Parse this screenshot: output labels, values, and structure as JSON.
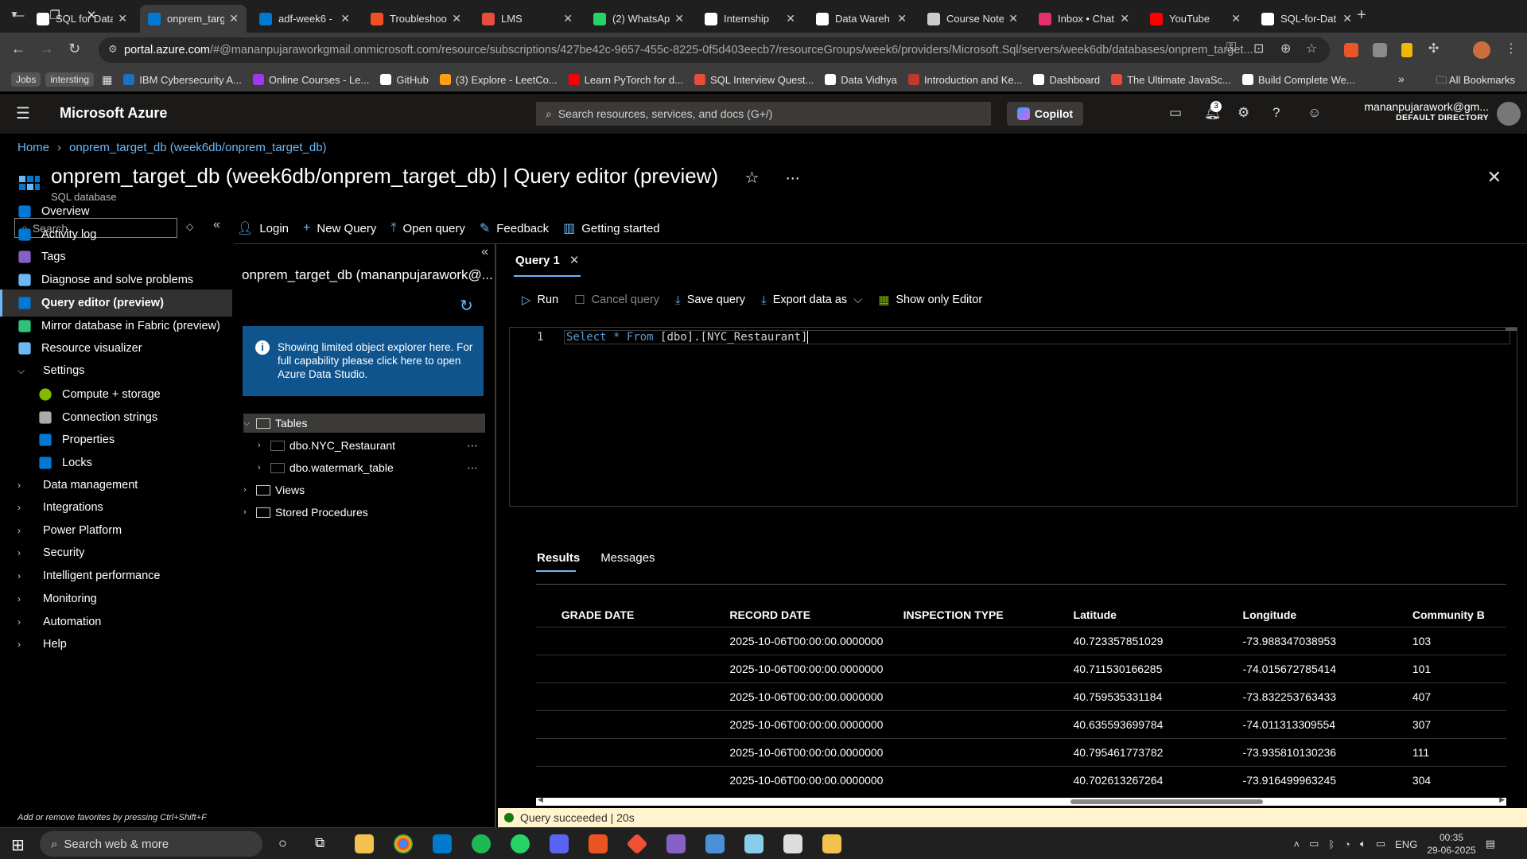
{
  "browser": {
    "tabs": [
      {
        "label": "SQL for Data",
        "color": "#ffffff",
        "active": false
      },
      {
        "label": "onprem_targ",
        "color": "#0078d4",
        "active": true
      },
      {
        "label": "adf-week6 -",
        "color": "#0078d4",
        "active": false
      },
      {
        "label": "Troubleshoot",
        "color": "#f25022",
        "active": false
      },
      {
        "label": "LMS",
        "color": "#e74c3c",
        "active": false
      },
      {
        "label": "(2) WhatsAp",
        "color": "#25d366",
        "active": false
      },
      {
        "label": "Internship",
        "color": "#ffffff",
        "active": false
      },
      {
        "label": "Data Wareh",
        "color": "#ffffff",
        "active": false
      },
      {
        "label": "Course Note",
        "color": "#cccccc",
        "active": false
      },
      {
        "label": "Inbox • Chat",
        "color": "#e1306c",
        "active": false
      },
      {
        "label": "YouTube",
        "color": "#ff0000",
        "active": false
      },
      {
        "label": "SQL-for-Dat",
        "color": "#ffffff",
        "active": false
      }
    ],
    "url_host": "portal.azure.com",
    "url_path": "/#@mananpujaraworkgmail.onmicrosoft.com/resource/subscriptions/427be42c-9657-455c-8225-0f5d403eecb7/resourceGroups/week6/providers/Microsoft.Sql/servers/week6db/databases/onprem_target...",
    "bookmarks_chips": [
      "Jobs",
      "intersting"
    ],
    "bookmarks": [
      {
        "label": "IBM Cybersecurity A...",
        "color": "#1f70c1"
      },
      {
        "label": "Online Courses - Le...",
        "color": "#a435f0"
      },
      {
        "label": "GitHub",
        "color": "#ffffff"
      },
      {
        "label": "(3) Explore - LeetCo...",
        "color": "#ffa116"
      },
      {
        "label": "Learn PyTorch for d...",
        "color": "#ff0000"
      },
      {
        "label": "SQL Interview Quest...",
        "color": "#e74c3c"
      },
      {
        "label": "Data Vidhya",
        "color": "#ffffff"
      },
      {
        "label": "Introduction and Ke...",
        "color": "#c0392b"
      },
      {
        "label": "Dashboard",
        "color": "#ffffff"
      },
      {
        "label": "The Ultimate JavaSc...",
        "color": "#e74c3c"
      },
      {
        "label": "Build Complete We...",
        "color": "#ffffff"
      }
    ],
    "all_bookmarks": "All Bookmarks"
  },
  "azure": {
    "brand": "Microsoft Azure",
    "search_placeholder": "Search resources, services, and docs (G+/)",
    "copilot": "Copilot",
    "notif_count": "3",
    "account_email": "mananpujarawork@gm...",
    "account_dir": "DEFAULT DIRECTORY"
  },
  "page": {
    "breadcrumb_home": "Home",
    "breadcrumb_db": "onprem_target_db (week6db/onprem_target_db)",
    "title": "onprem_target_db (week6db/onprem_target_db) | Query editor (preview)",
    "subtitle": "SQL database"
  },
  "nav": {
    "search_placeholder": "Search",
    "items": [
      {
        "label": "Overview",
        "icon": "sql-db-icon",
        "color": "#0078d4"
      },
      {
        "label": "Activity log",
        "icon": "log-icon",
        "color": "#0078d4"
      },
      {
        "label": "Tags",
        "icon": "tag-icon",
        "color": "#8661c5"
      },
      {
        "label": "Diagnose and solve problems",
        "icon": "wrench-icon",
        "color": "#6cb8f6"
      },
      {
        "label": "Query editor (preview)",
        "icon": "query-icon",
        "color": "#0078d4"
      },
      {
        "label": "Mirror database in Fabric (preview)",
        "icon": "fabric-icon",
        "color": "#2ec27e"
      },
      {
        "label": "Resource visualizer",
        "icon": "visualizer-icon",
        "color": "#6cb8f6"
      },
      {
        "label": "Settings",
        "icon": "chevron-down-icon"
      },
      {
        "label": "Compute + storage",
        "icon": "compute-icon",
        "color": "#7fba00"
      },
      {
        "label": "Connection strings",
        "icon": "link-icon",
        "color": "#aaaaaa"
      },
      {
        "label": "Properties",
        "icon": "properties-icon",
        "color": "#0078d4"
      },
      {
        "label": "Locks",
        "icon": "lock-icon",
        "color": "#0078d4"
      },
      {
        "label": "Data management",
        "icon": "chevron-right-icon"
      },
      {
        "label": "Integrations",
        "icon": "chevron-right-icon"
      },
      {
        "label": "Power Platform",
        "icon": "chevron-right-icon"
      },
      {
        "label": "Security",
        "icon": "chevron-right-icon"
      },
      {
        "label": "Intelligent performance",
        "icon": "chevron-right-icon"
      },
      {
        "label": "Monitoring",
        "icon": "chevron-right-icon"
      },
      {
        "label": "Automation",
        "icon": "chevron-right-icon"
      },
      {
        "label": "Help",
        "icon": "chevron-right-icon"
      }
    ],
    "hint": "Add or remove favorites by pressing Ctrl+Shift+F"
  },
  "toolbar": {
    "login": "Login",
    "new_query": "New Query",
    "open_query": "Open query",
    "feedback": "Feedback",
    "getting_started": "Getting started"
  },
  "explorer": {
    "title": "onprem_target_db (mananpujarawork@...",
    "banner": "Showing limited object explorer here. For full capability please click here to open Azure Data Studio.",
    "tables": "Tables",
    "table1": "dbo.NYC_Restaurant",
    "table2": "dbo.watermark_table",
    "views": "Views",
    "procs": "Stored Procedures"
  },
  "editor": {
    "tab": "Query 1",
    "run": "Run",
    "cancel": "Cancel query",
    "save": "Save query",
    "export": "Export data as",
    "show_only": "Show only Editor",
    "line_no": "1",
    "kw_select": "Select",
    "star": "*",
    "kw_from": "From",
    "object": "[dbo].[NYC_Restaurant]"
  },
  "results": {
    "tab_results": "Results",
    "tab_messages": "Messages",
    "columns": [
      "GRADE DATE",
      "RECORD DATE",
      "INSPECTION TYPE",
      "Latitude",
      "Longitude",
      "Community B"
    ],
    "rows": [
      [
        "",
        "2025-10-06T00:00:00.0000000",
        "",
        "40.723357851029",
        "-73.988347038953",
        "103"
      ],
      [
        "",
        "2025-10-06T00:00:00.0000000",
        "",
        "40.711530166285",
        "-74.015672785414",
        "101"
      ],
      [
        "",
        "2025-10-06T00:00:00.0000000",
        "",
        "40.759535331184",
        "-73.832253763433",
        "407"
      ],
      [
        "",
        "2025-10-06T00:00:00.0000000",
        "",
        "40.635593699784",
        "-74.011313309554",
        "307"
      ],
      [
        "",
        "2025-10-06T00:00:00.0000000",
        "",
        "40.795461773782",
        "-73.935810130236",
        "111"
      ],
      [
        "",
        "2025-10-06T00:00:00.0000000",
        "",
        "40.702613267264",
        "-73.916499963245",
        "304"
      ]
    ],
    "status": "Query succeeded | 20s"
  },
  "taskbar": {
    "search": "Search web & more",
    "lang": "ENG",
    "time": "00:35",
    "date": "29-06-2025"
  }
}
